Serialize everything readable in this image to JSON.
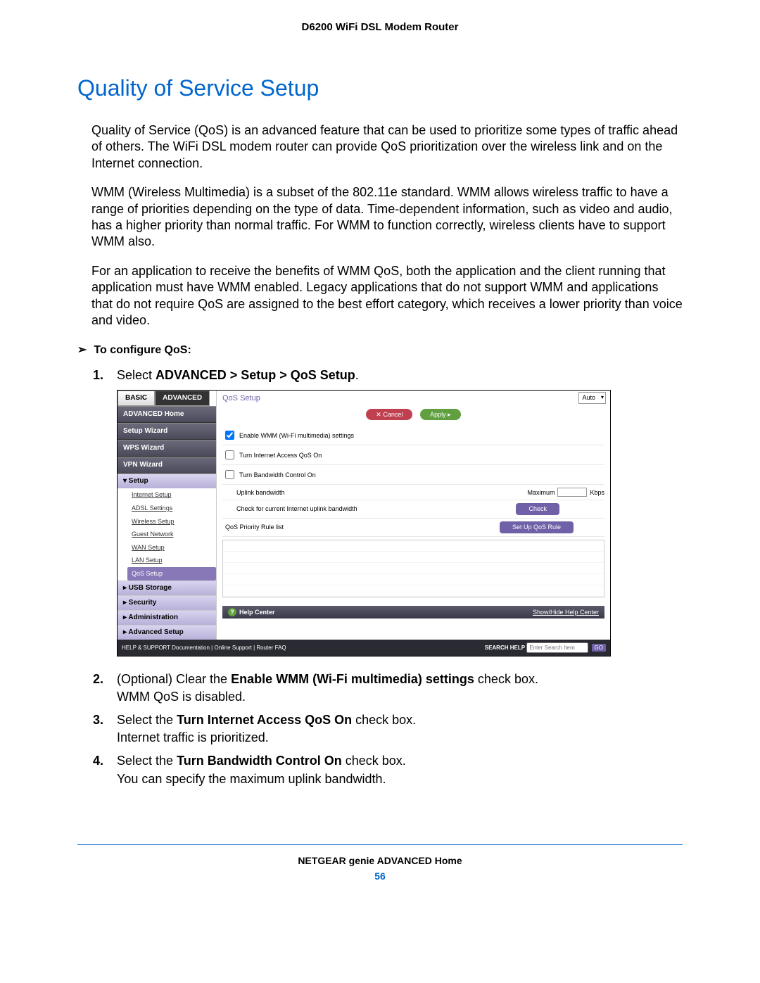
{
  "doc_header": "D6200 WiFi DSL Modem Router",
  "section_title": "Quality of Service Setup",
  "paragraphs": [
    "Quality of Service (QoS) is an advanced feature that can be used to prioritize some types of traffic ahead of others. The WiFi DSL modem router can provide QoS prioritization over the wireless link and on the Internet connection.",
    "WMM (Wireless Multimedia) is a subset of the 802.11e standard. WMM allows wireless traffic to have a range of priorities depending on the type of data. Time-dependent information, such as video and audio, has a higher priority than normal traffic. For WMM to function correctly, wireless clients have to support WMM also.",
    "For an application to receive the benefits of WMM QoS, both the application and the client running that application must have WMM enabled. Legacy applications that do not support WMM and applications that do not require QoS are assigned to the best effort category, which receives a lower priority than voice and video."
  ],
  "procedure_heading": "To configure QoS:",
  "steps": {
    "s1_a": "Select ",
    "s1_b": "ADVANCED > Setup > QoS Setup",
    "s1_c": ".",
    "s2_a": "(Optional) Clear the ",
    "s2_b": "Enable WMM (Wi-Fi multimedia) settings",
    "s2_c": " check box.",
    "s2_d": "WMM QoS is disabled.",
    "s3_a": "Select the ",
    "s3_b": "Turn Internet Access QoS On",
    "s3_c": " check box.",
    "s3_d": "Internet traffic is prioritized.",
    "s4_a": "Select the ",
    "s4_b": "Turn Bandwidth Control On",
    "s4_c": " check box.",
    "s4_d": "You can specify the maximum uplink bandwidth."
  },
  "ui": {
    "tabs": {
      "basic": "BASIC",
      "advanced": "ADVANCED"
    },
    "auto": "Auto",
    "nav": {
      "home": "ADVANCED Home",
      "setup_wizard": "Setup Wizard",
      "wps_wizard": "WPS Wizard",
      "vpn_wizard": "VPN Wizard",
      "setup": "▾ Setup",
      "sub": {
        "internet": "Internet Setup",
        "adsl": "ADSL Settings",
        "wireless": "Wireless Setup",
        "guest": "Guest Network",
        "wan": "WAN Setup",
        "lan": "LAN Setup",
        "qos": "QoS Setup"
      },
      "usb": "▸ USB Storage",
      "security": "▸ Security",
      "admin": "▸ Administration",
      "advanced_setup": "▸ Advanced Setup"
    },
    "content": {
      "title": "QoS Setup",
      "cancel": "Cancel",
      "apply": "Apply",
      "cb1": "Enable WMM (Wi-Fi multimedia) settings",
      "cb2": "Turn Internet Access QoS On",
      "cb3": "Turn Bandwidth Control On",
      "uplink": "Uplink bandwidth",
      "maximum": "Maximum",
      "kbps": "Kbps",
      "check_label": "Check for current Internet uplink bandwidth",
      "check_btn": "Check",
      "rule_label": "QoS Priority Rule list",
      "rule_btn": "Set Up QoS Rule"
    },
    "helpcenter": {
      "label": "Help Center",
      "show": "Show/Hide Help Center"
    },
    "footer": {
      "left": "HELP & SUPPORT  Documentation | Online Support | Router FAQ",
      "search_label": "SEARCH HELP",
      "search_placeholder": "Enter Search Item",
      "go": "GO"
    }
  },
  "footer_title": "NETGEAR genie ADVANCED Home",
  "page_number": "56"
}
